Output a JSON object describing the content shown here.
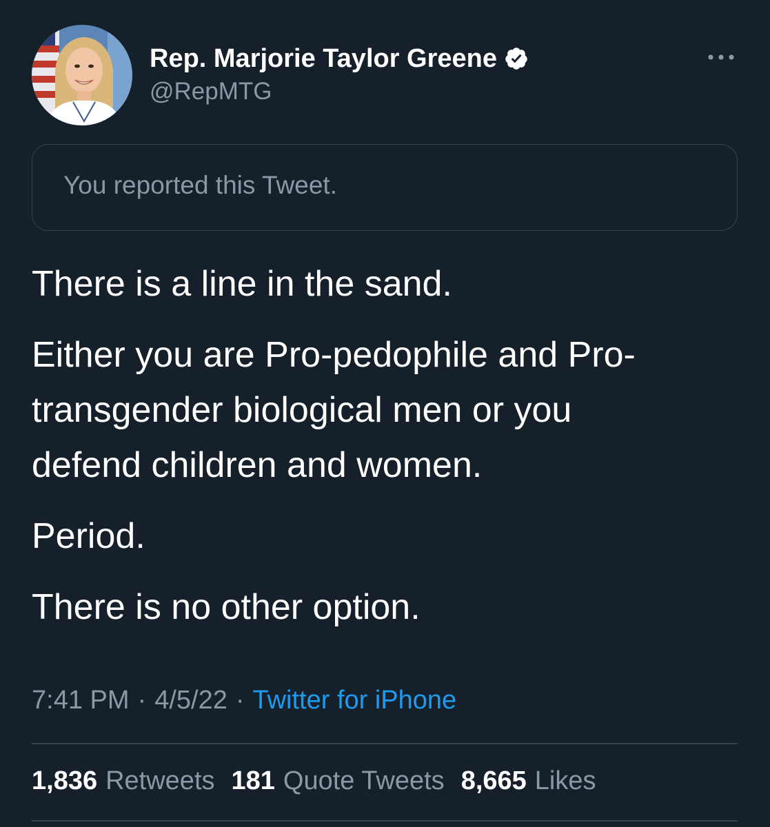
{
  "author": {
    "display_name": "Rep. Marjorie Taylor Greene",
    "handle": "@RepMTG",
    "verified": true
  },
  "notice": {
    "text": "You reported this Tweet."
  },
  "tweet": {
    "paragraphs": [
      "There is a line in the sand.",
      "Either you are Pro-pedophile and Pro-\ntransgender biological men or you\ndefend children and women.",
      "Period.",
      "There is no other option."
    ]
  },
  "meta": {
    "time": "7:41 PM",
    "separator": "·",
    "date": "4/5/22",
    "source": "Twitter for iPhone"
  },
  "stats": {
    "retweets_count": "1,836",
    "retweets_label": "Retweets",
    "quotes_count": "181",
    "quotes_label": "Quote Tweets",
    "likes_count": "8,665",
    "likes_label": "Likes"
  },
  "colors": {
    "background": "#15202b",
    "text_primary": "#ffffff",
    "text_secondary": "#8b98a5",
    "link": "#1d9bf0",
    "border": "#38444d"
  },
  "icons": {
    "verified": "verified-badge-icon",
    "more": "more-options-icon"
  }
}
